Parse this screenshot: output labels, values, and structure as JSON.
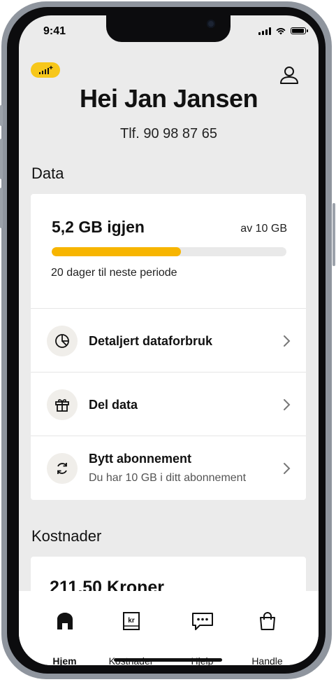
{
  "status_bar": {
    "time": "9:41"
  },
  "header": {
    "greeting": "Hei Jan Jansen",
    "phone": "Tlf. 90 98 87 65"
  },
  "data_section": {
    "title": "Data",
    "remaining": "5,2 GB igjen",
    "total": "av 10 GB",
    "usage_fraction": 0.55,
    "days_left": "20 dager til neste periode",
    "actions": [
      {
        "label": "Detaljert dataforbruk",
        "icon": "pie-chart-icon"
      },
      {
        "label": "Del data",
        "icon": "gift-icon"
      },
      {
        "label": "Bytt abonnement",
        "sub": "Du har 10 GB i ditt abonnement",
        "icon": "swap-icon"
      }
    ]
  },
  "cost_section": {
    "title": "Kostnader",
    "amount": "211,50 Kroner"
  },
  "tabbar": {
    "tabs": [
      {
        "label": "Hjem",
        "icon": "home-icon",
        "active": true
      },
      {
        "label": "Kostnader",
        "icon": "receipt-icon",
        "active": false
      },
      {
        "label": "Hjelp",
        "icon": "chat-icon",
        "active": false
      },
      {
        "label": "Handle",
        "icon": "shopping-bag-icon",
        "active": false
      }
    ]
  },
  "colors": {
    "accent": "#f7b500",
    "badge": "#f7c71a",
    "background": "#ebebeb"
  }
}
